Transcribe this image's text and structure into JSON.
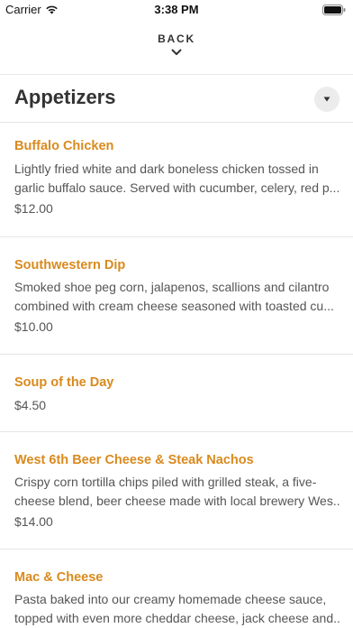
{
  "status_bar": {
    "carrier": "Carrier",
    "time": "3:38 PM"
  },
  "nav": {
    "back_label": "BACK"
  },
  "section": {
    "title": "Appetizers"
  },
  "items": [
    {
      "name": "Buffalo Chicken",
      "desc_line1": "Lightly fried white and dark boneless chicken tossed in",
      "desc_line2": "garlic buffalo sauce. Served with cucumber, celery, red p...",
      "price": "$12.00"
    },
    {
      "name": "Southwestern Dip",
      "desc_line1": "Smoked shoe peg corn, jalapenos, scallions and cilantro",
      "desc_line2": "combined with cream cheese seasoned with toasted cu...",
      "price": "$10.00"
    },
    {
      "name": "Soup of the Day",
      "price": "$4.50"
    },
    {
      "name": "West 6th Beer Cheese & Steak Nachos",
      "desc_line1": "Crispy corn tortilla chips piled with grilled steak, a five-",
      "desc_line2": "cheese blend, beer cheese made with local brewery Wes...",
      "price": "$14.00"
    },
    {
      "name": "Mac & Cheese",
      "desc_line1": "Pasta baked into our creamy homemade cheese sauce,",
      "desc_line2": "topped with even more cheddar cheese, jack cheese and..."
    }
  ],
  "colors": {
    "accent": "#d98a1e",
    "text": "#333333",
    "muted": "#555555",
    "divider": "#e6e6e6"
  },
  "icons": {
    "wifi": "wifi-icon",
    "battery": "battery-icon",
    "back_chevron": "chevron-down-icon",
    "collapse": "caret-down-icon"
  }
}
